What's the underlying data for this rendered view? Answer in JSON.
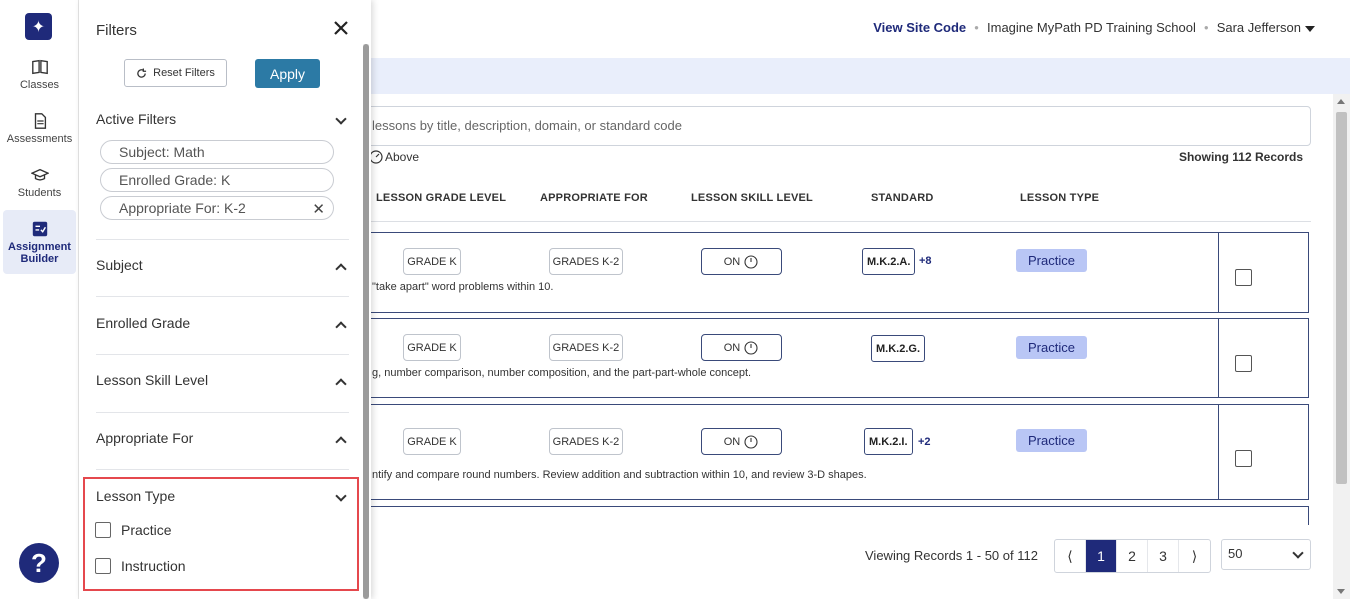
{
  "nav": {
    "items": [
      {
        "label": "Classes",
        "icon": "book-icon"
      },
      {
        "label": "Assessments",
        "icon": "document-icon"
      },
      {
        "label": "Students",
        "icon": "graduation-cap-icon"
      },
      {
        "label": "Assignment Builder",
        "icon": "checklist-icon"
      }
    ],
    "help_label": "?"
  },
  "header": {
    "view_site_code": "View Site Code",
    "school": "Imagine MyPath PD Training School",
    "user": "Sara  Jefferson"
  },
  "main": {
    "search_placeholder": "lessons by title, description, domain, or standard code",
    "above_label": "Above",
    "showing": "Showing 112 Records",
    "columns": [
      "LESSON GRADE LEVEL",
      "APPROPRIATE FOR",
      "LESSON SKILL LEVEL",
      "STANDARD",
      "LESSON TYPE"
    ],
    "rows": [
      {
        "grade": "GRADE K",
        "appropriate": "GRADES K-2",
        "skill": "ON",
        "standard": "M.K.2.A.",
        "extra": "+8",
        "type": "Practice",
        "desc": "\"take apart\" word problems within 10."
      },
      {
        "grade": "GRADE K",
        "appropriate": "GRADES K-2",
        "skill": "ON",
        "standard": "M.K.2.G.",
        "extra": "",
        "type": "Practice",
        "desc": "g, number comparison, number composition, and the part-part-whole concept."
      },
      {
        "grade": "GRADE K",
        "appropriate": "GRADES K-2",
        "skill": "ON",
        "standard": "M.K.2.I.",
        "extra": "+2",
        "type": "Practice",
        "desc": "ntify and compare round numbers. Review addition and subtraction within 10, and review 3-D shapes."
      }
    ],
    "pagination": {
      "viewing": "Viewing Records 1 - 50 of 112",
      "prev": "⟨",
      "pages": [
        "1",
        "2",
        "3"
      ],
      "next": "⟩",
      "per_page": "50"
    }
  },
  "filters": {
    "title": "Filters",
    "reset_label": "Reset Filters",
    "apply_label": "Apply",
    "active_title": "Active Filters",
    "active": [
      "Subject: Math",
      "Enrolled Grade: K",
      "Appropriate For: K-2"
    ],
    "sections": [
      "Subject",
      "Enrolled Grade",
      "Lesson Skill Level",
      "Appropriate For"
    ],
    "lesson_type": {
      "title": "Lesson Type",
      "options": [
        "Practice",
        "Instruction"
      ]
    }
  },
  "colors": {
    "brand": "#1f2a7a",
    "apply": "#2c7aa5",
    "highlight": "#e5484d",
    "practice_badge": "#b9c6f5"
  }
}
